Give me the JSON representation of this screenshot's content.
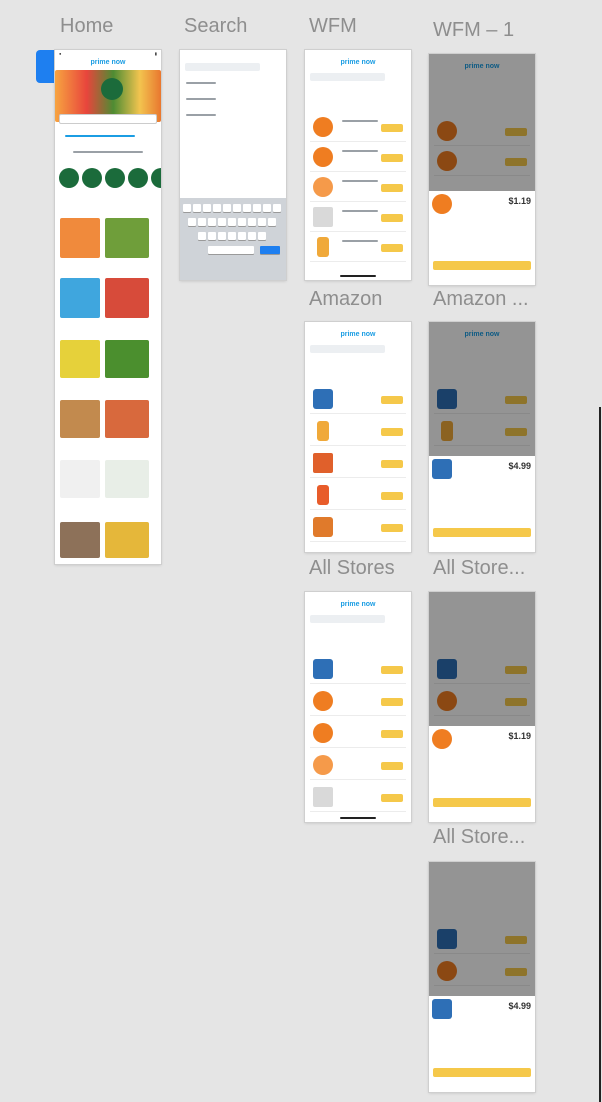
{
  "canvas": {
    "background": "#e5e5e5",
    "selection_color": "#1e7ff0",
    "frames": [
      {
        "id": "home",
        "label": "Home"
      },
      {
        "id": "search",
        "label": "Search"
      },
      {
        "id": "wfm",
        "label": "WFM"
      },
      {
        "id": "wfm1",
        "label": "WFM – 1"
      },
      {
        "id": "amazon",
        "label": "Amazon"
      },
      {
        "id": "amazon2",
        "label": "Amazon ..."
      },
      {
        "id": "allstores",
        "label": "All Stores"
      },
      {
        "id": "allstores2",
        "label": "All Store..."
      },
      {
        "id": "allstores3",
        "label": "All Store..."
      }
    ]
  },
  "app": {
    "logo": "prime now",
    "brand_color": "#1b9de3",
    "accent_color": "#f5c84a"
  },
  "prices": {
    "wfm1_popup": "$1.19",
    "amazon2_popup": "$4.99",
    "allstores2_popup": "$1.19",
    "allstores3_popup": "$4.99"
  }
}
